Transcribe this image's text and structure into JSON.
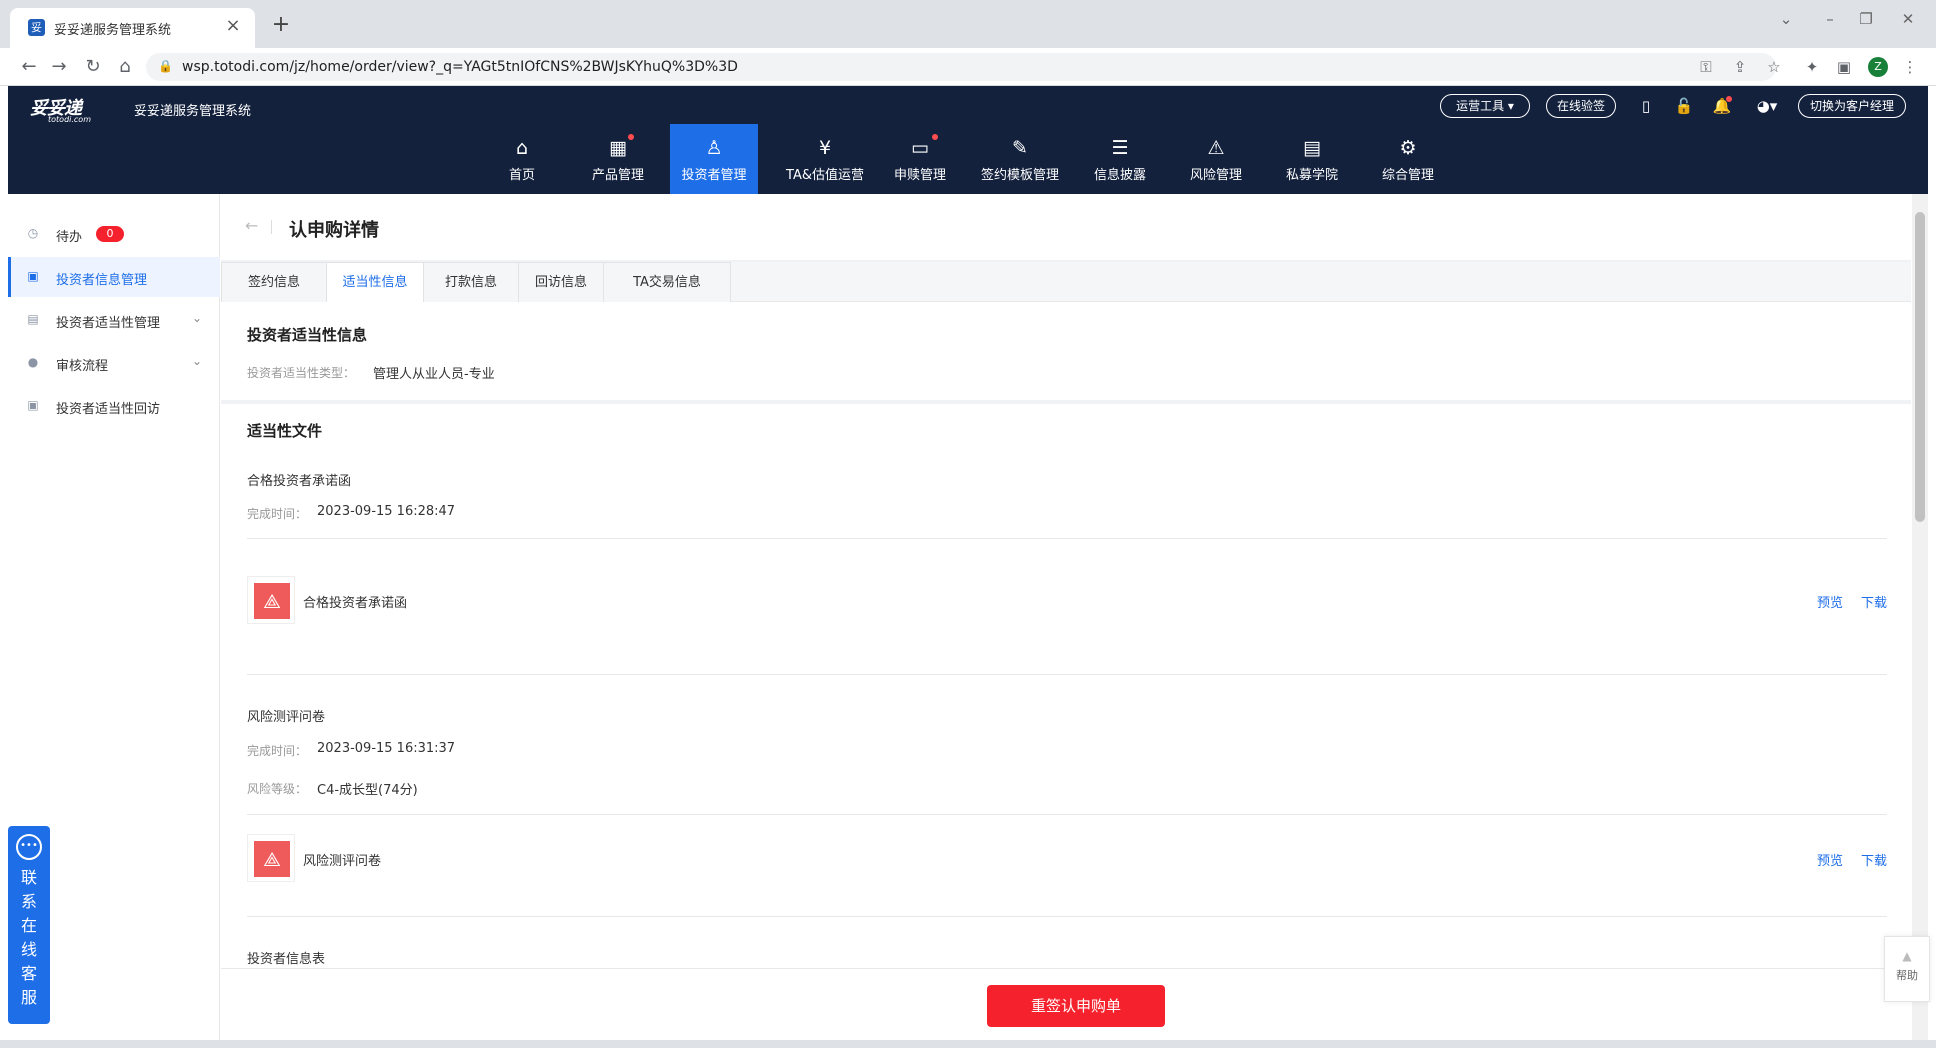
{
  "browser": {
    "tab_title": "妥妥递服务管理系统",
    "tab_favicon": "妥",
    "url": "wsp.totodi.com/jz/home/order/view?_q=YAGt5tnIOfCNS%2BWJsKYhuQ%3D%3D",
    "profile_initial": "Z",
    "icons": [
      "back-icon",
      "forward-icon",
      "reload-icon",
      "home-icon",
      "lock-icon",
      "key-icon",
      "share-icon",
      "star-icon",
      "extensions-icon",
      "sidepanel-icon",
      "menu-icon"
    ]
  },
  "header": {
    "logo_text": "妥妥递",
    "logo_sub": "totodi.com",
    "app_title": "妥妥递服务管理系统",
    "ops_tools": "运营工具 ▾",
    "online_sign": "在线验签",
    "switch_manager": "切换为客户经理"
  },
  "menu": [
    {
      "label": "首页",
      "icon": "⌂",
      "dot": false
    },
    {
      "label": "产品管理",
      "icon": "▦",
      "dot": true
    },
    {
      "label": "投资者管理",
      "icon": "♙",
      "dot": false,
      "active": true
    },
    {
      "label": "TA&估值运营",
      "icon": "¥",
      "dot": false
    },
    {
      "label": "申赎管理",
      "icon": "▭",
      "dot": true
    },
    {
      "label": "签约模板管理",
      "icon": "✎",
      "dot": false
    },
    {
      "label": "信息披露",
      "icon": "☰",
      "dot": false
    },
    {
      "label": "风险管理",
      "icon": "⚠",
      "dot": false
    },
    {
      "label": "私募学院",
      "icon": "▤",
      "dot": false
    },
    {
      "label": "综合管理",
      "icon": "⚙",
      "dot": false
    }
  ],
  "sidebar": {
    "items": [
      {
        "label": "待办",
        "badge": "0"
      },
      {
        "label": "投资者信息管理",
        "active": true
      },
      {
        "label": "投资者适当性管理",
        "chevron": true
      },
      {
        "label": "审核流程",
        "chevron": true
      },
      {
        "label": "投资者适当性回访"
      }
    ]
  },
  "page": {
    "title": "认申购详情",
    "back_glyph": "←",
    "tabs": [
      "签约信息",
      "适当性信息",
      "打款信息",
      "回访信息",
      "TA交易信息"
    ],
    "active_tab": 1
  },
  "suitability": {
    "title": "投资者适当性信息",
    "type_label": "投资者适当性类型：",
    "type_value": "管理人从业人员-专业"
  },
  "documents": {
    "title": "适当性文件",
    "items": [
      {
        "name": "合格投资者承诺函",
        "time_label": "完成时间：",
        "time_value": "2023-09-15 16:28:47",
        "file_name": "合格投资者承诺函"
      },
      {
        "name": "风险测评问卷",
        "time_label": "完成时间：",
        "time_value": "2023-09-15 16:31:37",
        "risk_label": "风险等级：",
        "risk_value": "C4-成长型(74分)",
        "file_name": "风险测评问卷"
      },
      {
        "name": "投资者信息表"
      }
    ],
    "preview": "预览",
    "download": "下载"
  },
  "footer": {
    "resign_button": "重签认申购单"
  },
  "help": {
    "arrow": "▲",
    "label": "帮助"
  },
  "support": {
    "text": "联系在线客服"
  },
  "colors": {
    "header_bg": "#13213d",
    "accent": "#1e6ee8",
    "danger": "#f5222d",
    "pdf": "#ef5a5a"
  }
}
